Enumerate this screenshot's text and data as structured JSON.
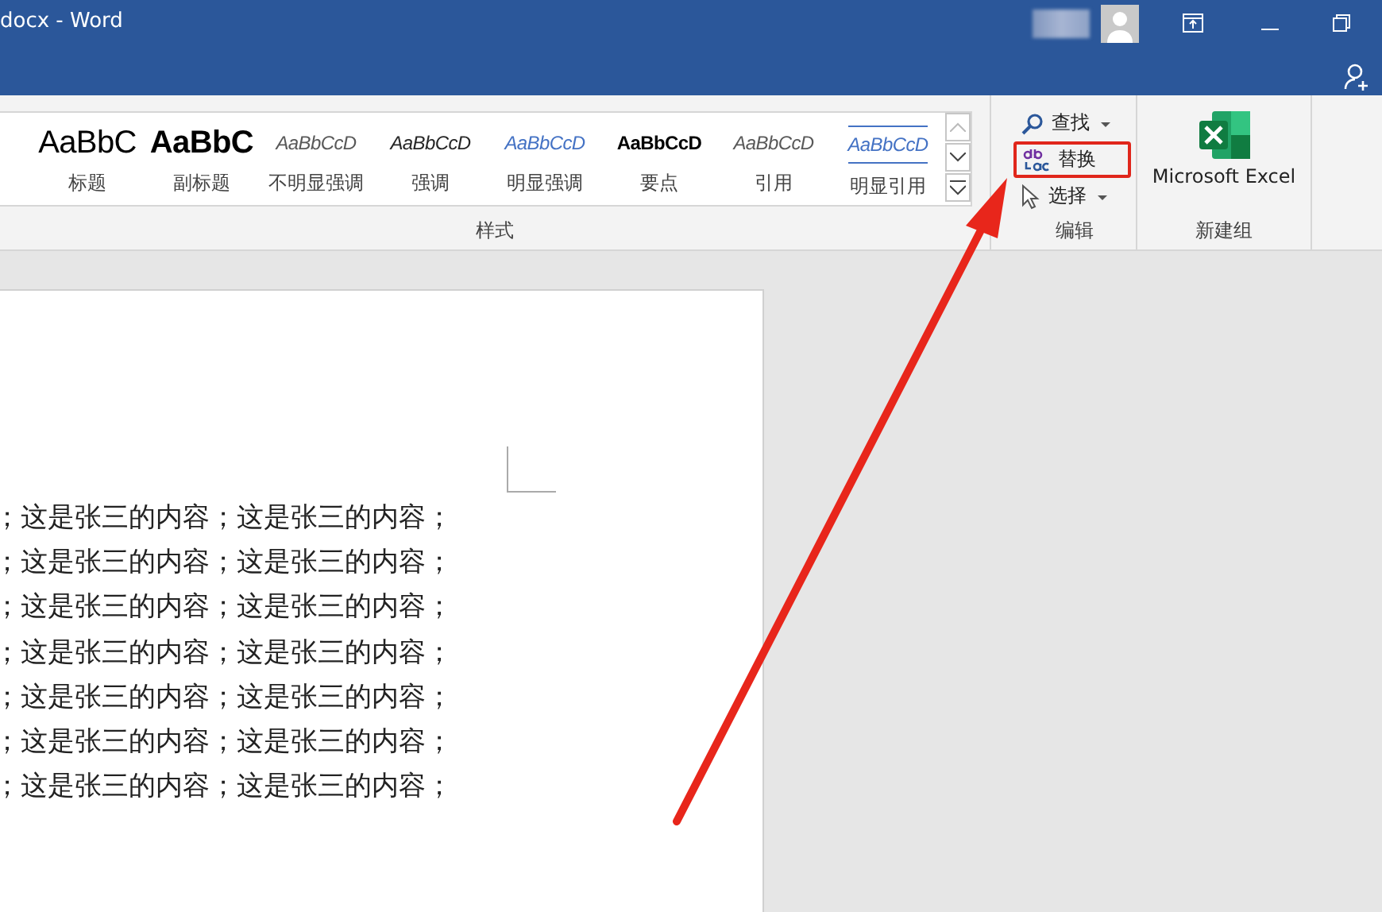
{
  "window": {
    "title": "docx - Word"
  },
  "ribbon": {
    "styles": {
      "group_label": "样式",
      "items": [
        {
          "preview": "AaBbC",
          "label": "标题",
          "kind": "heading"
        },
        {
          "preview": "AaBbC",
          "label": "副标题",
          "kind": "subtitle"
        },
        {
          "preview": "AaBbCcD",
          "label": "不明显强调",
          "kind": "subtle"
        },
        {
          "preview": "AaBbCcD",
          "label": "强调",
          "kind": "emphasis"
        },
        {
          "preview": "AaBbCcD",
          "label": "明显强调",
          "kind": "intense"
        },
        {
          "preview": "AaBbCcD",
          "label": "要点",
          "kind": "strong"
        },
        {
          "preview": "AaBbCcD",
          "label": "引用",
          "kind": "quote"
        },
        {
          "preview": "AaBbCcD",
          "label": "明显引用",
          "kind": "intense-quote"
        }
      ]
    },
    "editing": {
      "group_label": "编辑",
      "items": [
        {
          "label": "查找",
          "kind": "find",
          "dropdown": true,
          "highlighted": false
        },
        {
          "label": "替换",
          "kind": "replace",
          "dropdown": false,
          "highlighted": true
        },
        {
          "label": "选择",
          "kind": "select",
          "dropdown": true,
          "highlighted": false
        }
      ]
    },
    "new_group": {
      "group_label": "新建组",
      "button": "Microsoft Excel"
    }
  },
  "document": {
    "lines": [
      "；这是张三的内容；这是张三的内容；",
      "；这是张三的内容；这是张三的内容；",
      "；这是张三的内容；这是张三的内容；",
      "；这是张三的内容；这是张三的内容；",
      "；这是张三的内容；这是张三的内容；",
      "；这是张三的内容；这是张三的内容；",
      "；这是张三的内容；这是张三的内容；"
    ]
  }
}
